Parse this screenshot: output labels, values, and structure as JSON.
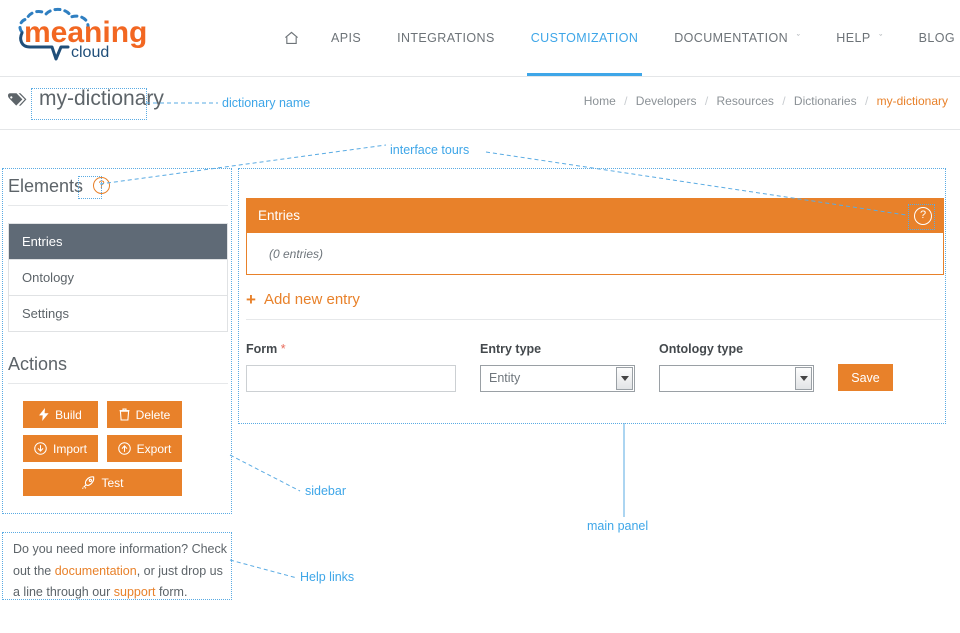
{
  "brand": {
    "name_primary": "meaning",
    "name_secondary": "cloud",
    "accent_orange": "#e8812a",
    "accent_blue": "#3ea6e8",
    "logo_blue": "#1f4e79",
    "sidebar_active": "#5f6a76"
  },
  "nav": {
    "home_icon": "home-icon",
    "items": [
      {
        "label": "APIS",
        "active": false,
        "caret": false
      },
      {
        "label": "INTEGRATIONS",
        "active": false,
        "caret": false
      },
      {
        "label": "CUSTOMIZATION",
        "active": true,
        "caret": false
      },
      {
        "label": "DOCUMENTATION",
        "active": false,
        "caret": true
      },
      {
        "label": "HELP",
        "active": false,
        "caret": true
      },
      {
        "label": "BLOG",
        "active": false,
        "caret": false
      }
    ],
    "caret_glyph": "ˇ"
  },
  "title": {
    "icon": "tag-icon",
    "dictionary_name": "my-dictionary"
  },
  "breadcrumb": {
    "separator": "/",
    "items": [
      "Home",
      "Developers",
      "Resources",
      "Dictionaries"
    ],
    "current": "my-dictionary"
  },
  "sidebar": {
    "elements_heading": "Elements",
    "help_glyph": "?",
    "items": [
      {
        "label": "Entries",
        "active": true
      },
      {
        "label": "Ontology",
        "active": false
      },
      {
        "label": "Settings",
        "active": false
      }
    ],
    "actions_heading": "Actions",
    "buttons": [
      {
        "label": "Build",
        "icon": "bolt-icon",
        "wide": false
      },
      {
        "label": "Delete",
        "icon": "trash-icon",
        "wide": false
      },
      {
        "label": "Import",
        "icon": "download-circle-icon",
        "wide": false
      },
      {
        "label": "Export",
        "icon": "upload-circle-icon",
        "wide": false
      },
      {
        "label": "Test",
        "icon": "rocket-icon",
        "wide": true
      }
    ]
  },
  "help_links": {
    "text_1": "Do you need more information? Check out the ",
    "link_1": "documentation",
    "text_2": ", or just drop us a line through our ",
    "link_2": "support",
    "text_3": " form."
  },
  "main": {
    "panel_title": "Entries",
    "panel_help_glyph": "?",
    "entries_count": "(0 entries)",
    "add_entry_label": "Add new entry",
    "add_entry_plus": "+",
    "form": {
      "form_label": "Form",
      "form_required_mark": "*",
      "form_value": "",
      "entry_type_label": "Entry type",
      "entry_type_value": "Entity",
      "ontology_type_label": "Ontology type",
      "ontology_type_value": "",
      "save_label": "Save"
    }
  },
  "annotations": [
    {
      "label": "dictionary name"
    },
    {
      "label": "interface tours"
    },
    {
      "label": "sidebar"
    },
    {
      "label": "main panel"
    },
    {
      "label": "Help links"
    }
  ]
}
